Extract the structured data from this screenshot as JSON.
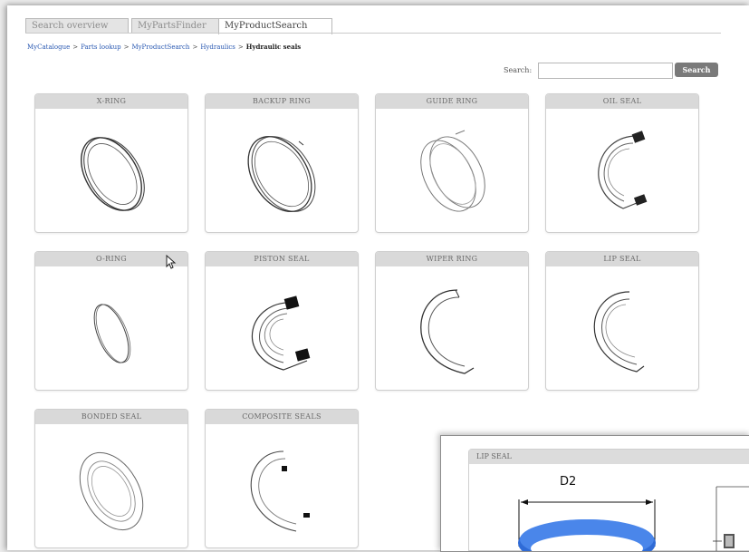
{
  "tabs": [
    {
      "label": "Search overview",
      "active": false
    },
    {
      "label": "MyPartsFinder",
      "active": false
    },
    {
      "label": "MyProductSearch",
      "active": true
    }
  ],
  "breadcrumb": {
    "items": [
      "MyCatalogue",
      "Parts lookup",
      "MyProductSearch",
      "Hydraulics"
    ],
    "separator": ">",
    "current": "Hydraulic seals"
  },
  "search": {
    "label": "Search:",
    "value": "",
    "button": "Search"
  },
  "cards": [
    {
      "title": "X-RING",
      "icon": "x-ring-icon"
    },
    {
      "title": "BACKUP RING",
      "icon": "backup-ring-icon"
    },
    {
      "title": "GUIDE RING",
      "icon": "guide-ring-icon"
    },
    {
      "title": "OIL SEAL",
      "icon": "oil-seal-icon"
    },
    {
      "title": "O-RING",
      "icon": "o-ring-icon"
    },
    {
      "title": "PISTON SEAL",
      "icon": "piston-seal-icon"
    },
    {
      "title": "WIPER RING",
      "icon": "wiper-ring-icon"
    },
    {
      "title": "LIP SEAL",
      "icon": "lip-seal-icon"
    },
    {
      "title": "BONDED SEAL",
      "icon": "bonded-seal-icon"
    },
    {
      "title": "COMPOSITE SEALS",
      "icon": "composite-seals-icon"
    }
  ],
  "popup": {
    "title": "LIP SEAL",
    "dimension_label": "D2",
    "ring_color": "#2f6bd6"
  }
}
